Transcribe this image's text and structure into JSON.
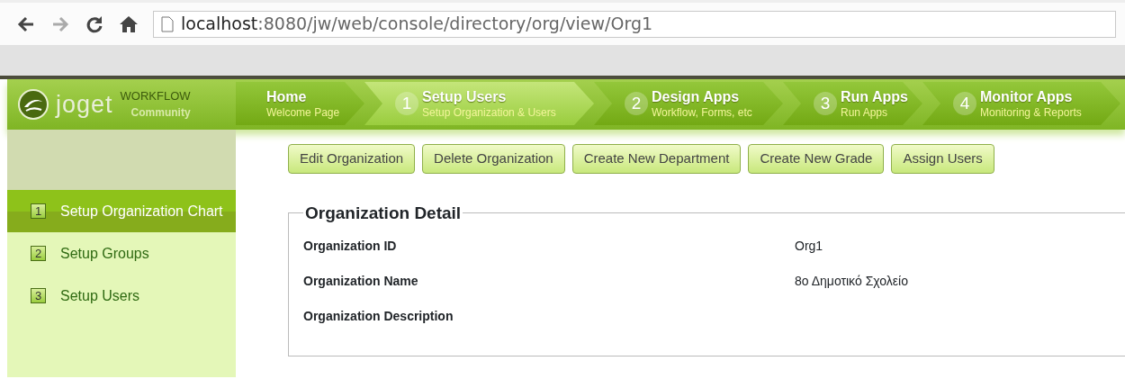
{
  "browser": {
    "url_host": "localhost",
    "url_path": ":8080/jw/web/console/directory/org/view/Org1"
  },
  "logo": {
    "name": "joget",
    "product": "WORKFLOW",
    "edition": "Community"
  },
  "steps": [
    {
      "title": "Home",
      "subtitle": "Welcome Page",
      "selected": false
    },
    {
      "number": "1",
      "title": "Setup Users",
      "subtitle": "Setup Organization & Users",
      "selected": true
    },
    {
      "number": "2",
      "title": "Design Apps",
      "subtitle": "Workflow, Forms, etc",
      "selected": false
    },
    {
      "number": "3",
      "title": "Run Apps",
      "subtitle": "Run Apps",
      "selected": false
    },
    {
      "number": "4",
      "title": "Monitor Apps",
      "subtitle": "Monitoring & Reports",
      "selected": false
    }
  ],
  "sidebar": {
    "items": [
      {
        "number": "1",
        "label": "Setup Organization Chart",
        "selected": true
      },
      {
        "number": "2",
        "label": "Setup Groups",
        "selected": false
      },
      {
        "number": "3",
        "label": "Setup Users",
        "selected": false
      }
    ]
  },
  "buttons": [
    "Edit Organization",
    "Delete Organization",
    "Create New Department",
    "Create New Grade",
    "Assign Users"
  ],
  "detail": {
    "title": "Organization Detail",
    "fields": [
      {
        "label": "Organization ID",
        "value": "Org1"
      },
      {
        "label": "Organization Name",
        "value": "8ο Δημοτικό Σχολείο"
      },
      {
        "label": "Organization Description"
      }
    ]
  }
}
